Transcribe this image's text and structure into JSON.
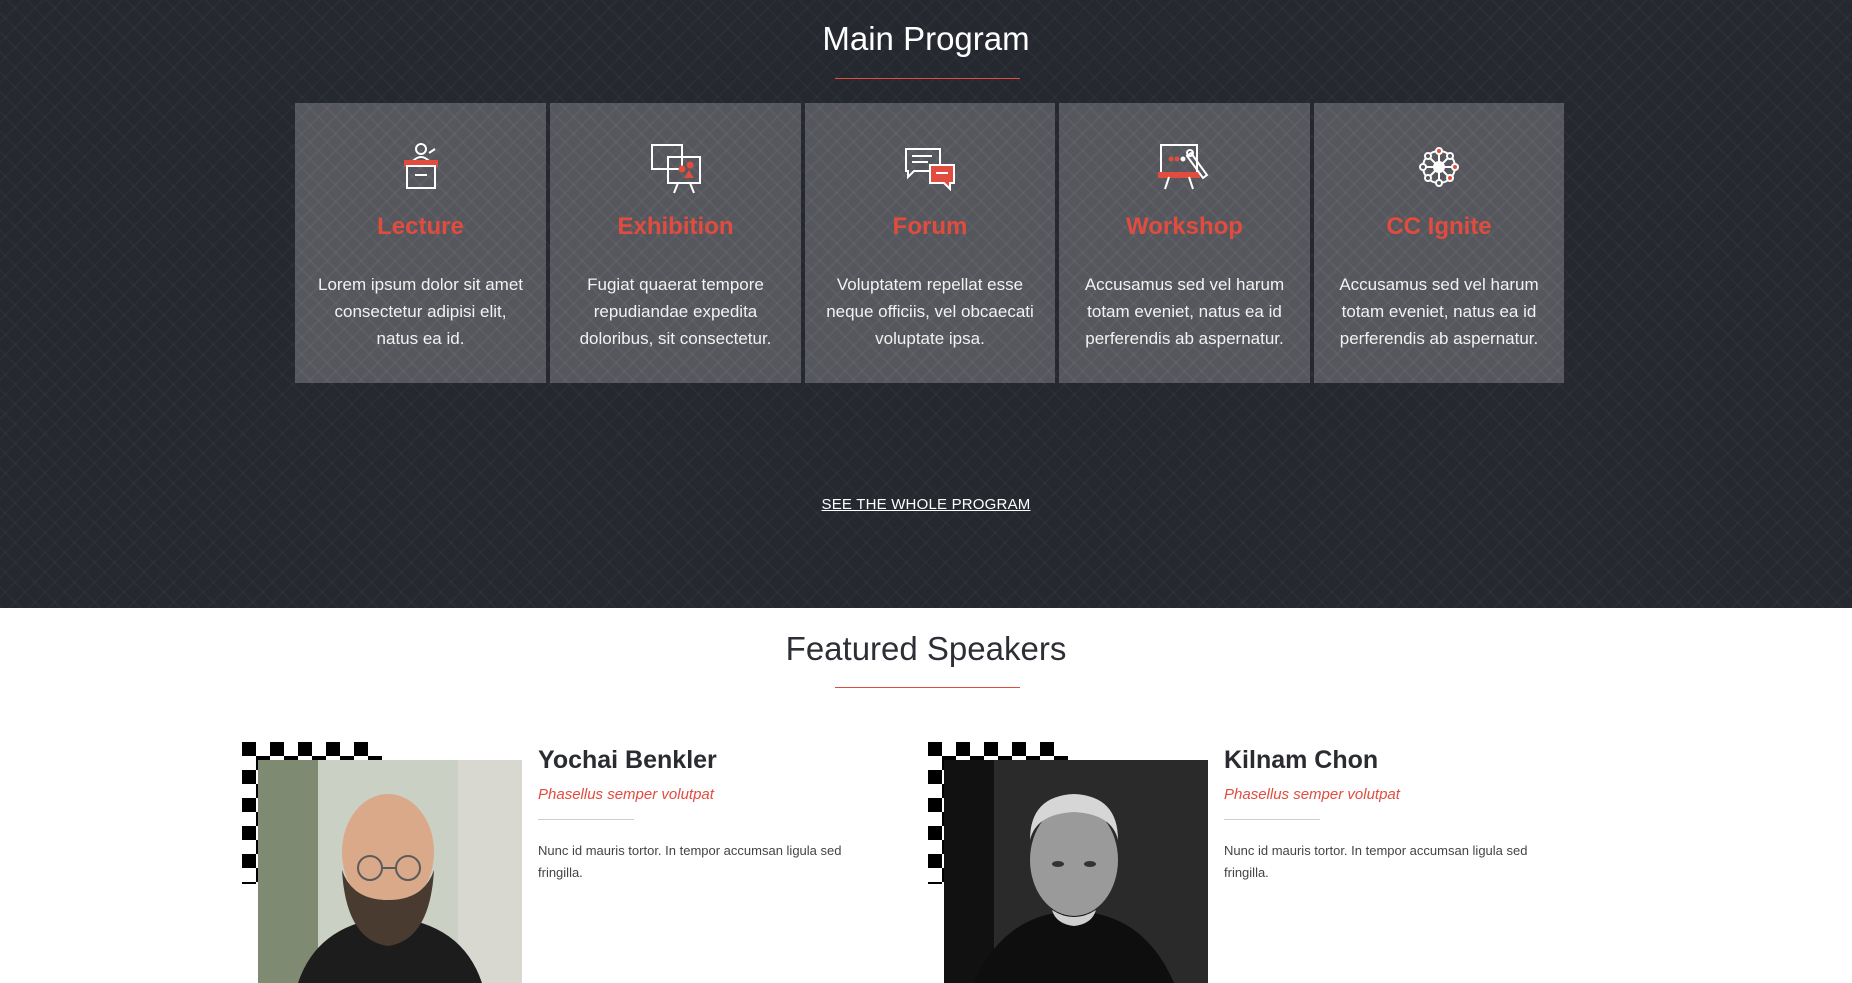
{
  "program": {
    "title": "Main Program",
    "cards": [
      {
        "icon": "podium-icon",
        "title": "Lecture",
        "text": "Lorem ipsum dolor sit amet consectetur adipisi elit, natus ea id."
      },
      {
        "icon": "easel-board-icon",
        "title": "Exhibition",
        "text": "Fugiat quaerat tempore repudiandae expedita doloribus, sit consectetur."
      },
      {
        "icon": "chat-bubbles-icon",
        "title": "Forum",
        "text": "Voluptatem repellat esse neque officiis, vel obcaecati voluptate ipsa."
      },
      {
        "icon": "whiteboard-pen-icon",
        "title": "Workshop",
        "text": "Accusamus sed vel harum totam eveniet, natus ea id perferendis ab aspernatur."
      },
      {
        "icon": "network-hub-icon",
        "title": "CC Ignite",
        "text": "Accusamus sed vel harum totam eveniet, natus ea id perferendis ab aspernatur."
      }
    ],
    "link_label": "SEE THE WHOLE PROGRAM"
  },
  "speakers": {
    "title": "Featured Speakers",
    "items": [
      {
        "name": "Yochai Benkler",
        "role": "Phasellus semper volutpat",
        "bio": "Nunc id mauris tortor. In tempor accumsan ligula sed fringilla."
      },
      {
        "name": "Kilnam Chon",
        "role": "Phasellus semper volutpat",
        "bio": "Nunc id mauris tortor. In tempor accumsan ligula sed fringilla."
      }
    ]
  },
  "colors": {
    "accent": "#e24c3f",
    "dark_bg": "#262830",
    "card_bg": "#56575d"
  }
}
